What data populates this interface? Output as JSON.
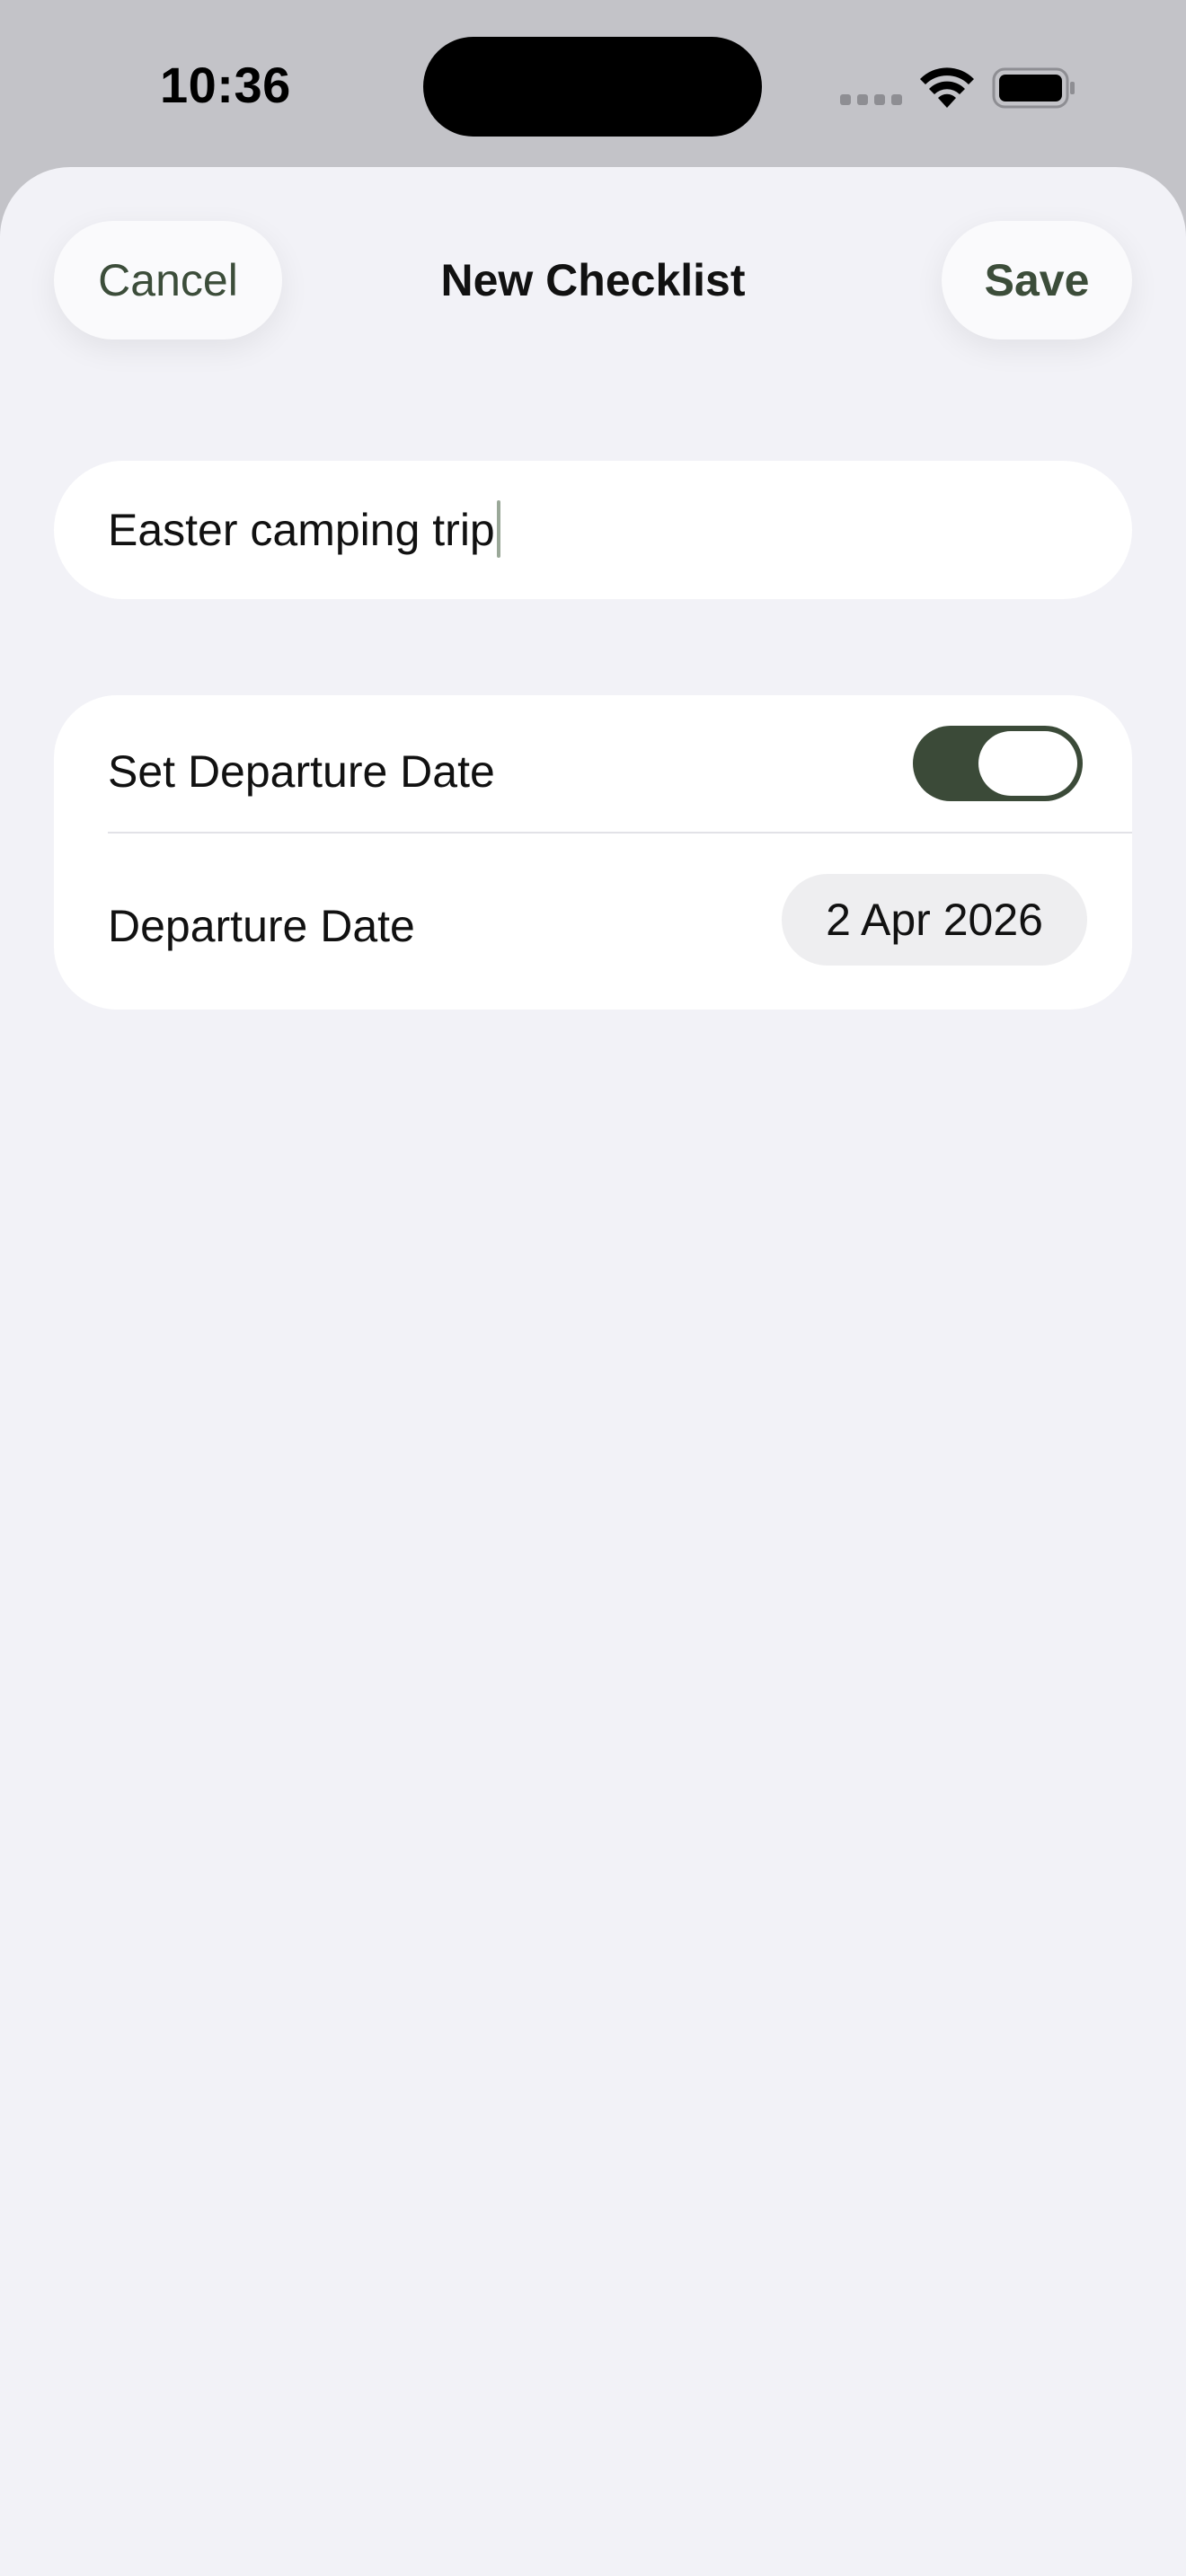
{
  "status_bar": {
    "time": "10:36",
    "icons": [
      "cellular-signal-icon",
      "wifi-icon",
      "battery-icon"
    ]
  },
  "nav": {
    "cancel_label": "Cancel",
    "title": "New Checklist",
    "save_label": "Save"
  },
  "form": {
    "name_value": "Easter camping trip",
    "set_departure_label": "Set Departure Date",
    "set_departure_enabled": true,
    "departure_label": "Departure Date",
    "departure_value": "2 Apr 2026"
  },
  "colors": {
    "accent": "#3b4a38",
    "sheet_background": "#f2f2f7",
    "status_background": "#c3c3c8"
  }
}
